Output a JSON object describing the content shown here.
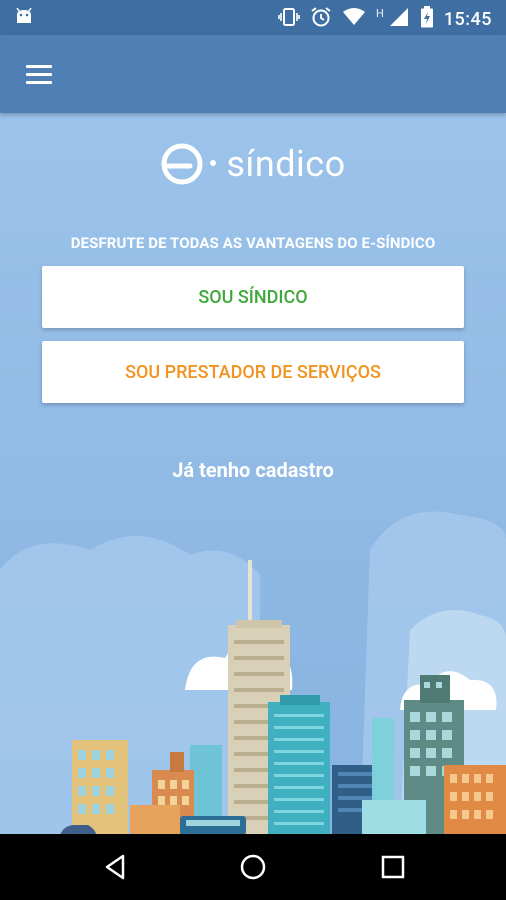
{
  "status_bar": {
    "time": "15:45",
    "network_label": "H",
    "icons": [
      "android-notification-icon",
      "vibrate-icon",
      "alarm-icon",
      "wifi-icon",
      "cell-signal-icon",
      "battery-charging-icon"
    ]
  },
  "app_bar": {
    "menu_icon": "hamburger-menu-icon"
  },
  "logo": {
    "text": "síndico",
    "mark": "e"
  },
  "main": {
    "tagline": "DESFRUTE DE TODAS AS VANTAGENS DO E-SÍNDICO",
    "sindico_button": "SOU SÍNDICO",
    "prestador_button": "SOU PRESTADOR DE SERVIÇOS",
    "login_link": "Já tenho cadastro"
  },
  "colors": {
    "status_bar": "#3f6fa2",
    "app_bar": "#4f7fb3",
    "background": "#8fb9e4",
    "sindico_green": "#3fa83a",
    "prestador_orange": "#f29320"
  },
  "nav_bar": {
    "icons": [
      "back-icon",
      "home-icon",
      "recents-icon"
    ]
  }
}
